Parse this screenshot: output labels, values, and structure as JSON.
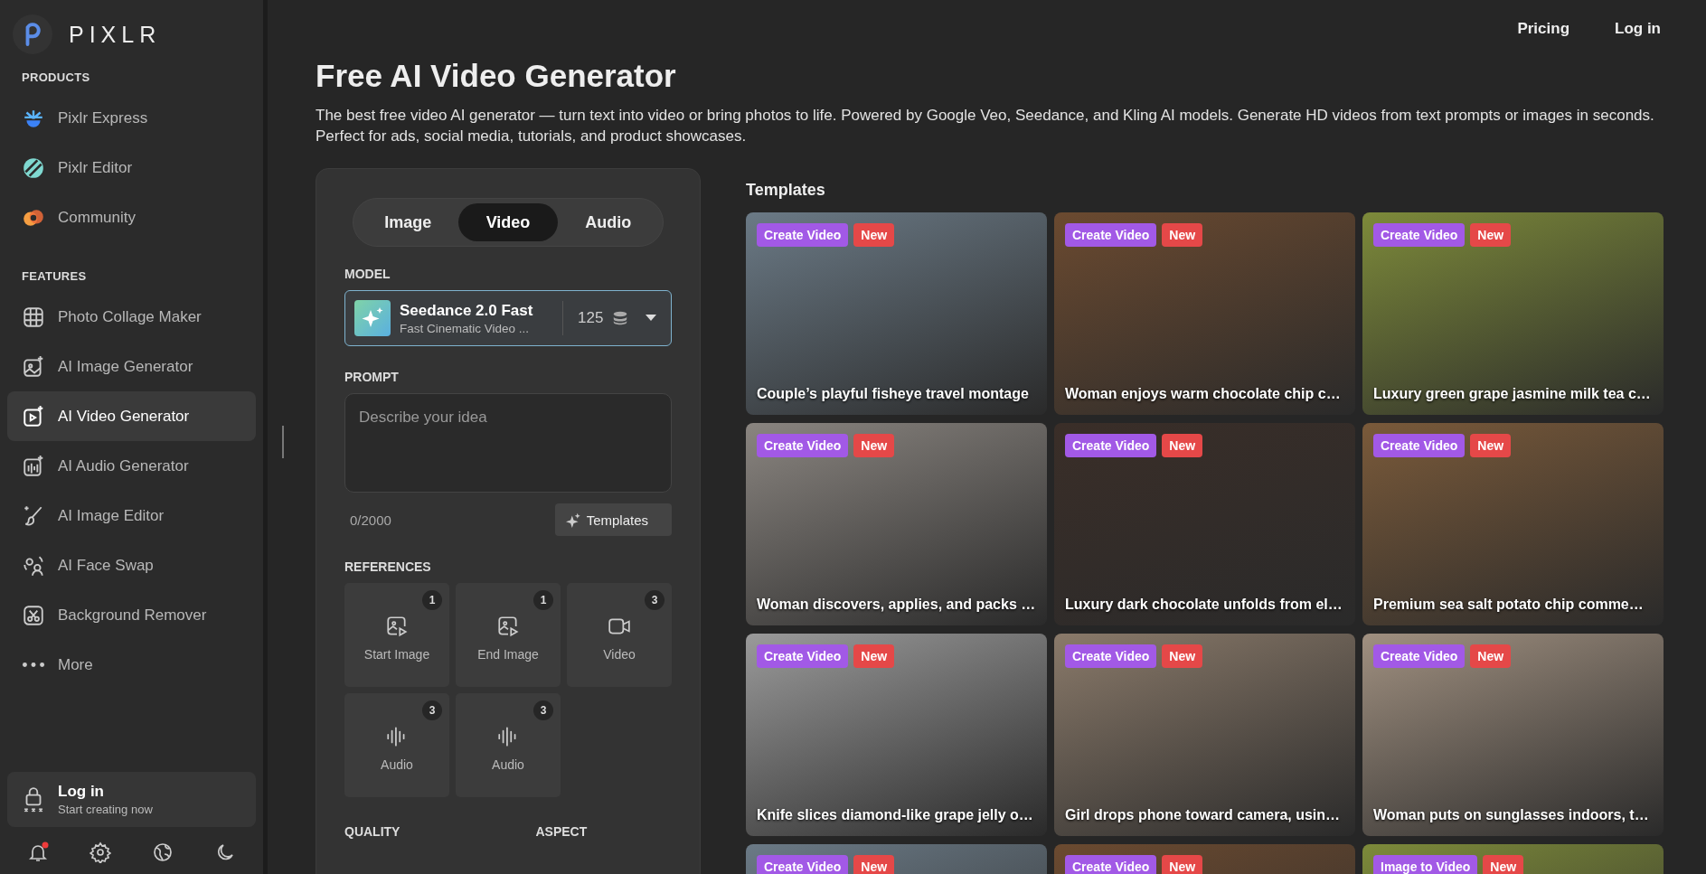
{
  "sidebar": {
    "logo": "PIXLR",
    "sections": [
      {
        "title": "PRODUCTS",
        "items": [
          {
            "label": "Pixlr Express",
            "kind": "express",
            "selected": false
          },
          {
            "label": "Pixlr Editor",
            "kind": "editor",
            "selected": false
          },
          {
            "label": "Community",
            "kind": "community",
            "selected": false
          }
        ]
      },
      {
        "title": "FEATURES",
        "items": [
          {
            "label": "Photo Collage Maker",
            "kind": "collage",
            "selected": false
          },
          {
            "label": "AI Image Generator",
            "kind": "image-gen",
            "selected": false
          },
          {
            "label": "AI Video Generator",
            "kind": "video-gen",
            "selected": true
          },
          {
            "label": "AI Audio Generator",
            "kind": "audio-gen",
            "selected": false
          },
          {
            "label": "AI Image Editor",
            "kind": "image-edit",
            "selected": false
          },
          {
            "label": "AI Face Swap",
            "kind": "face-swap",
            "selected": false
          },
          {
            "label": "Background Remover",
            "kind": "bg-remove",
            "selected": false
          },
          {
            "label": "More",
            "kind": "more",
            "selected": false
          }
        ]
      }
    ],
    "login": {
      "title": "Log in",
      "subtitle": "Start creating now"
    },
    "footer_icons": [
      {
        "kind": "bell",
        "has_notification": true
      },
      {
        "kind": "gear",
        "has_notification": false
      },
      {
        "kind": "globe",
        "has_notification": false
      },
      {
        "kind": "moon",
        "has_notification": false
      }
    ]
  },
  "topnav": [
    "Pricing",
    "Log in"
  ],
  "page": {
    "title": "Free AI Video Generator",
    "description": "The best free video AI generator — turn text into video or bring photos to life. Powered by Google Veo, Seedance, and Kling AI models. Generate HD videos from text prompts or images in seconds. Perfect for ads, social media, tutorials, and product showcases."
  },
  "generator": {
    "tabs": [
      {
        "label": "Image",
        "selected": false
      },
      {
        "label": "Video",
        "selected": true
      },
      {
        "label": "Audio",
        "selected": false
      }
    ],
    "model_label": "MODEL",
    "model": {
      "name": "Seedance 2.0 Fast",
      "subtitle": "Fast Cinematic Video ...",
      "credits": "125"
    },
    "prompt_label": "PROMPT",
    "prompt": {
      "placeholder": "Describe your idea",
      "counter": "0/2000"
    },
    "templates_button": "Templates",
    "references_label": "REFERENCES",
    "references": [
      {
        "label": "Start Image",
        "count": "1",
        "kind": "image"
      },
      {
        "label": "End Image",
        "count": "1",
        "kind": "image"
      },
      {
        "label": "Video",
        "count": "3",
        "kind": "video"
      },
      {
        "label": "Audio",
        "count": "3",
        "kind": "audio"
      },
      {
        "label": "Audio",
        "count": "3",
        "kind": "audio"
      }
    ],
    "quality_label": "QUALITY",
    "aspect_label": "ASPECT"
  },
  "templates": {
    "title": "Templates",
    "cards": [
      {
        "action": "Create Video",
        "badge": "New",
        "caption": "Couple’s playful fisheye travel montage"
      },
      {
        "action": "Create Video",
        "badge": "New",
        "caption": "Woman enjoys warm chocolate chip c…"
      },
      {
        "action": "Create Video",
        "badge": "New",
        "caption": "Luxury green grape jasmine milk tea c…"
      },
      {
        "action": "Create Video",
        "badge": "New",
        "caption": "Woman discovers, applies, and packs …"
      },
      {
        "action": "Create Video",
        "badge": "New",
        "caption": "Luxury dark chocolate unfolds from el…"
      },
      {
        "action": "Create Video",
        "badge": "New",
        "caption": "Premium sea salt potato chip comme…"
      },
      {
        "action": "Create Video",
        "badge": "New",
        "caption": "Knife slices diamond-like grape jelly o…"
      },
      {
        "action": "Create Video",
        "badge": "New",
        "caption": "Girl drops phone toward camera, usin…"
      },
      {
        "action": "Create Video",
        "badge": "New",
        "caption": "Woman puts on sunglasses indoors, t…"
      },
      {
        "action": "Create Video",
        "badge": "New"
      },
      {
        "action": "Create Video",
        "badge": "New"
      },
      {
        "action": "Image to Video",
        "badge": "New"
      }
    ]
  }
}
